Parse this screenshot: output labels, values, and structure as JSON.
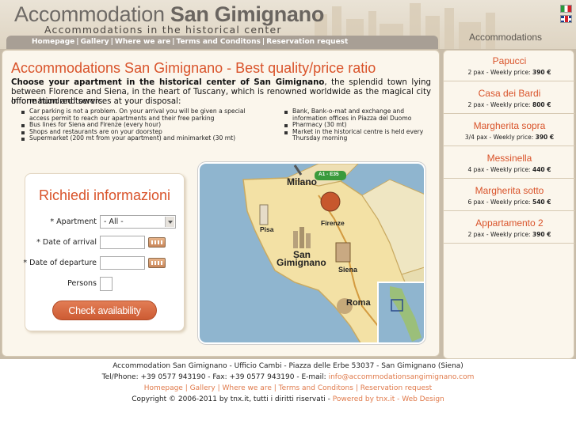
{
  "header": {
    "title_light": "Accommodation",
    "title_bold": "San Gimignano",
    "subtitle": "Accommodations in the historical center",
    "accommodations_tab": "Accommodations"
  },
  "nav": {
    "items": [
      "Homepage",
      "Gallery",
      "Where we are",
      "Terms and Conditons",
      "Reservation request"
    ],
    "separator": "|"
  },
  "main": {
    "title": "Accommodations San Gimignano - Best quality/price ratio",
    "intro_bold": "Choose your apartment in the historical center of San Gimignano",
    "intro_rest": ", the splendid town lying between Florence and Siena, in the heart of Tuscany, which is renowned worldwide as the magical city of one hundred towers.",
    "services_title": "Information and services at your disposal:",
    "services_left": [
      "Car parking is not a problem. On your arrival you will be given a special access permit to reach our apartments and their free parking",
      "Bus lines for Siena and Firenze (every hour)",
      "Shops and restaurants are on your doorstep",
      "Supermarket (200 mt from your apartment) and minimarket (30 mt)"
    ],
    "services_right": [
      "Bank, Bank-o-mat and exchange and information offices in Piazza del Duomo",
      "Pharmacy (30 mt)",
      "Market in the historical centre is held every Thursday morning"
    ]
  },
  "form": {
    "title": "Richiedi informazioni",
    "apartment_label": "* Apartment",
    "apartment_value": "- All -",
    "arrival_label": "* Date of arrival",
    "departure_label": "* Date of departure",
    "persons_label": "Persons",
    "button": "Check availability"
  },
  "map": {
    "labels": {
      "milano": "Milano",
      "highway": "A1 - E35",
      "pisa": "Pisa",
      "firenze": "Firenze",
      "san_gimignano_1": "San",
      "san_gimignano_2": "Gimignano",
      "siena": "Siena",
      "roma": "Roma"
    },
    "colors": {
      "sea": "#8fb5cf",
      "land": "#f3e1a5",
      "border": "#c9aa62"
    }
  },
  "accommodations": [
    {
      "name": "Papucci",
      "desc": "2 pax - Weekly price:",
      "price": "390 €"
    },
    {
      "name": "Casa dei Bardi",
      "desc": "2 pax - Weekly price:",
      "price": "800 €"
    },
    {
      "name": "Margherita sopra",
      "desc": "3/4 pax - Weekly price:",
      "price": "390 €"
    },
    {
      "name": "Messinella",
      "desc": "4 pax - Weekly price:",
      "price": "440 €"
    },
    {
      "name": "Margherita sotto",
      "desc": "6 pax - Weekly price:",
      "price": "540 €"
    },
    {
      "name": "Appartamento 2",
      "desc": "2 pax - Weekly price:",
      "price": "390 €"
    }
  ],
  "footer": {
    "line1": "Accommodation San Gimignano - Ufficio Cambi - Piazza delle Erbe 53037 - San Gimignano (Siena)",
    "line2_text": "Tel/Phone: +39 0577 943190 - Fax: +39 0577 943190 - E-mail:",
    "email": "info@accommodationsangimignano.com",
    "links": [
      "Homepage",
      "Gallery",
      "Where we are",
      "Terms and Conditons",
      "Reservation request"
    ],
    "copyright": "Copyright © 2006-2011 by tnx.it, tutti i diritti riservati -",
    "powered": "Powered by tnx.it - Web Design"
  },
  "colors": {
    "accent": "#d9532a",
    "nav_bg": "#a89f95",
    "panel_bg": "#fbf6ec",
    "page_bg": "#c8bca9"
  }
}
